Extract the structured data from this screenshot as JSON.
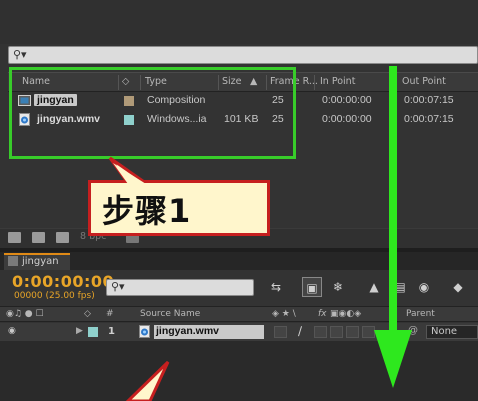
{
  "project": {
    "columns": {
      "name": "Name",
      "type": "Type",
      "size": "Size",
      "frame_rate": "Frame R...",
      "in_point": "In Point",
      "out_point": "Out Point"
    },
    "items": [
      {
        "icon": "composition-icon",
        "name": "jingyan",
        "label_color": "#b09a78",
        "type": "Composition",
        "size": "",
        "frame_rate": "25",
        "in_point": "0:00:00:00",
        "out_point": "0:00:07:15"
      },
      {
        "icon": "video-file-icon",
        "name": "jingyan.wmv",
        "label_color": "#8fd0cc",
        "type": "Windows...ia",
        "size": "101 KB",
        "frame_rate": "25",
        "in_point": "0:00:00:00",
        "out_point": "0:00:07:15"
      }
    ],
    "bpc": "8 bpc"
  },
  "callout": {
    "text": "步骤1"
  },
  "timeline": {
    "tab_label": "jingyan",
    "timecode": "0:00:00:00",
    "fps": "00000 (25.00 fps)",
    "search_placeholder": "",
    "columns": {
      "source_name": "Source Name",
      "parent": "Parent",
      "fx": "fx"
    },
    "layer": {
      "number": "1",
      "name": "jingyan.wmv",
      "label_color": "#8fd0cc",
      "parent": "None"
    }
  },
  "colors": {
    "highlight_box": "#38cc2a",
    "arrow": "#2ee81e",
    "callout_border": "#c61f1f",
    "callout_fill": "#fff6cc",
    "timecode": "#e8a528",
    "tab_accent": "#e08a16"
  }
}
